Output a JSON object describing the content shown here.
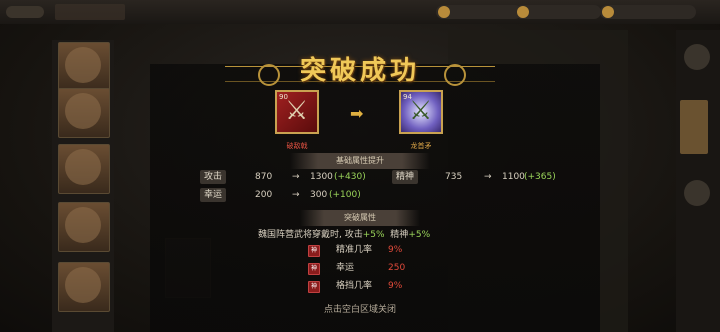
{
  "title": "突破成功",
  "before_item": {
    "level": "90",
    "name": "破敌戟"
  },
  "after_item": {
    "level": "94",
    "name": "龙首矛"
  },
  "base_section": {
    "label": "基础属性提升"
  },
  "stats": [
    {
      "label": "攻击",
      "old": "870",
      "new": "1300",
      "bonus": "(+430)"
    },
    {
      "label": "精神",
      "old": "735",
      "new": "1100",
      "bonus": "(+365)"
    },
    {
      "label": "幸运",
      "old": "200",
      "new": "300",
      "bonus": "(+100)"
    }
  ],
  "break_section": {
    "label": "突破属性"
  },
  "break_desc": {
    "text": "魏国阵营武将穿戴时, 攻击",
    "atk": "+5%",
    "mid": "精神",
    "spi": "+5%"
  },
  "break_bonuses": [
    {
      "icon": "神",
      "label": "精准几率",
      "value": "9%"
    },
    {
      "icon": "神",
      "label": "幸运",
      "value": "250"
    },
    {
      "icon": "神",
      "label": "格挡几率",
      "value": "9%"
    }
  ],
  "footer": "点击空白区域关闭",
  "colors": {
    "gold": "#f0c858",
    "green": "#9ad45a",
    "red": "#e04a3a"
  }
}
